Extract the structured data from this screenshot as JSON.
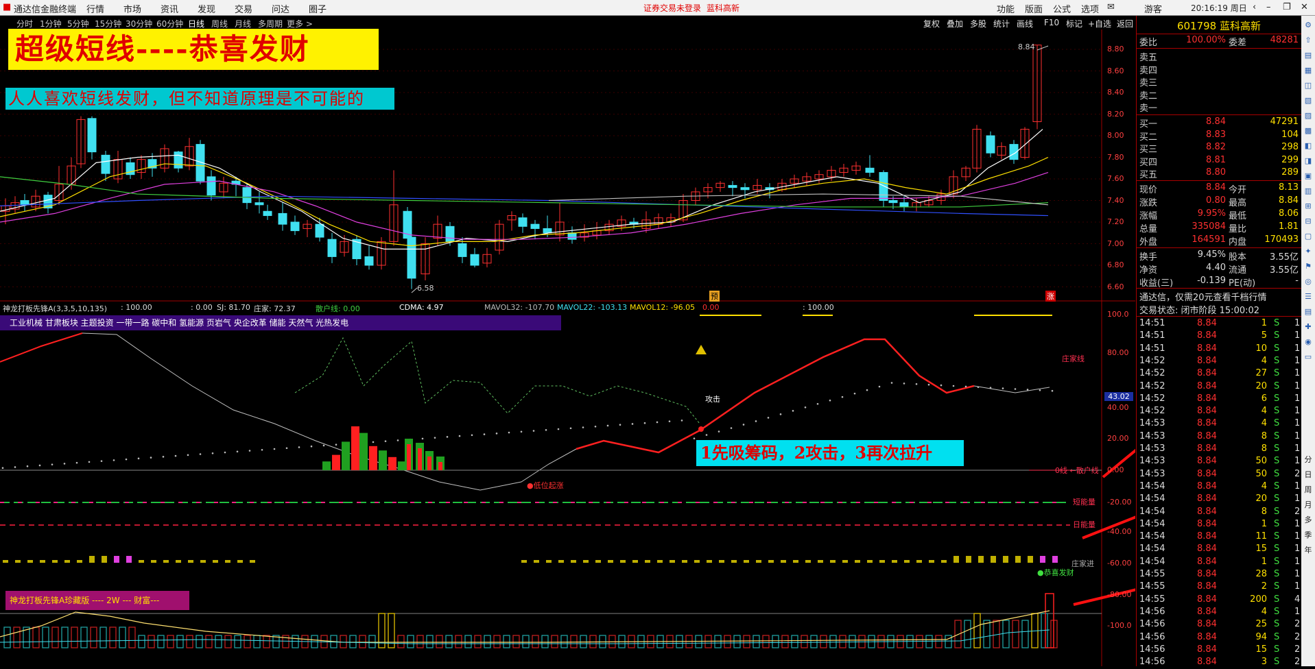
{
  "menubar": {
    "app_title": "通达信金融终端",
    "menus": [
      "行情",
      "市场",
      "资讯",
      "发现",
      "交易",
      "问达",
      "圈子"
    ],
    "login_notice": "证券交易未登录",
    "stock_link": "蓝科高新",
    "right_menus": [
      "功能",
      "版面",
      "公式",
      "选项"
    ],
    "user": "游客",
    "clock": "20:16:19 周日"
  },
  "periods": [
    "分时",
    "1分钟",
    "5分钟",
    "15分钟",
    "30分钟",
    "60分钟",
    "日线",
    "周线",
    "月线",
    "多周期",
    "更多 >"
  ],
  "active_period": "日线",
  "chart_tools": [
    "复权",
    "叠加",
    "多股",
    "统计",
    "画线",
    "F10",
    "标记",
    "+自选",
    "返回"
  ],
  "banners": {
    "title": "超级短线----恭喜发财",
    "subtitle": "人人喜欢短线发财，但不知道原理是不可能的",
    "steps": "1先吸筹码，2攻击，3再次拉升"
  },
  "price_axis": [
    "8.80",
    "8.60",
    "8.40",
    "8.20",
    "8.00",
    "7.80",
    "7.60",
    "7.40",
    "7.20",
    "7.00",
    "6.80",
    "6.60"
  ],
  "price_marks": {
    "high": "8.84",
    "low": "6.58"
  },
  "chart_badges": {
    "pre": "预",
    "up": "涨"
  },
  "indicator_line": {
    "name": "神龙打板先锋A(3,3,5,10,135)",
    "v1": ": 100.00",
    "v2": ": 0.00",
    "sj": "SJ: 81.70",
    "zhuangjia": "庄家: 72.37",
    "sanhu": "散户线: 0.00",
    "cdma": "CDMA: 4.97",
    "mavol32": "MAVOL32: -107.70",
    "mavol22": "MAVOL22: -103.13",
    "mavol12": "MAVOL12: -96.05",
    "v3": "0.00",
    "v4": ": 100.00"
  },
  "sector_tags": "工业机械 甘肃板块 主题投资 一带一路 碳中和 氢能源 页岩气 央企改革 储能 天然气 光热发电",
  "ind_axis": [
    "100.0",
    "80.00",
    "40.00",
    "20.00",
    "0.00",
    "-20.00",
    "-40.00",
    "-60.00",
    "-80.00",
    "-100.0"
  ],
  "ind_axis_highlight": "43.02",
  "ind_labels": {
    "zhuangjia": "庄家线",
    "attack": "攻击",
    "sanhu": "0线 ←散户线",
    "low_start": "●低位起涨",
    "short_energy": "短能量",
    "day_energy": "日能量",
    "zhuang_in": "庄家进",
    "gongxi": "●恭喜发财"
  },
  "vol_banner": "神龙打板先锋A珍藏版 ---- 2W --- 财富---",
  "quote": {
    "code": "601798",
    "name": "蓝科高新",
    "weibi_label": "委比",
    "weibi": "100.00%",
    "weicha_label": "委差",
    "weicha": "48281",
    "sells": [
      {
        "label": "卖五",
        "price": "",
        "vol": ""
      },
      {
        "label": "卖四",
        "price": "",
        "vol": ""
      },
      {
        "label": "卖三",
        "price": "",
        "vol": ""
      },
      {
        "label": "卖二",
        "price": "",
        "vol": ""
      },
      {
        "label": "卖一",
        "price": "",
        "vol": ""
      }
    ],
    "buys": [
      {
        "label": "买一",
        "price": "8.84",
        "vol": "47291"
      },
      {
        "label": "买二",
        "price": "8.83",
        "vol": "104"
      },
      {
        "label": "买三",
        "price": "8.82",
        "vol": "298"
      },
      {
        "label": "买四",
        "price": "8.81",
        "vol": "299"
      },
      {
        "label": "买五",
        "price": "8.80",
        "vol": "289"
      }
    ],
    "stats": [
      {
        "l1": "现价",
        "v1": "8.84",
        "l2": "今开",
        "v2": "8.13"
      },
      {
        "l1": "涨跌",
        "v1": "0.80",
        "l2": "最高",
        "v2": "8.84"
      },
      {
        "l1": "涨幅",
        "v1": "9.95%",
        "l2": "最低",
        "v2": "8.06"
      },
      {
        "l1": "总量",
        "v1": "335084",
        "l2": "量比",
        "v2": "1.81"
      },
      {
        "l1": "外盘",
        "v1": "164591",
        "l2": "内盘",
        "v2": "170493"
      }
    ],
    "stats2": [
      {
        "l1": "换手",
        "v1": "9.45%",
        "l2": "股本",
        "v2": "3.55亿"
      },
      {
        "l1": "净资",
        "v1": "4.40",
        "l2": "流通",
        "v2": "3.55亿"
      },
      {
        "l1": "收益(三)",
        "v1": "-0.139",
        "l2": "PE(动)",
        "v2": "-"
      }
    ],
    "ad": "通达信，仅需20元查看千档行情",
    "status": "交易状态: 闭市阶段 15:00:02"
  },
  "ticks": [
    {
      "t": "14:51",
      "p": "8.84",
      "v": "1",
      "s": "S",
      "n": "1"
    },
    {
      "t": "14:51",
      "p": "8.84",
      "v": "5",
      "s": "S",
      "n": "1"
    },
    {
      "t": "14:51",
      "p": "8.84",
      "v": "10",
      "s": "S",
      "n": "1"
    },
    {
      "t": "14:52",
      "p": "8.84",
      "v": "4",
      "s": "S",
      "n": "1"
    },
    {
      "t": "14:52",
      "p": "8.84",
      "v": "27",
      "s": "S",
      "n": "1"
    },
    {
      "t": "14:52",
      "p": "8.84",
      "v": "20",
      "s": "S",
      "n": "1"
    },
    {
      "t": "14:52",
      "p": "8.84",
      "v": "6",
      "s": "S",
      "n": "1"
    },
    {
      "t": "14:52",
      "p": "8.84",
      "v": "4",
      "s": "S",
      "n": "1"
    },
    {
      "t": "14:53",
      "p": "8.84",
      "v": "4",
      "s": "S",
      "n": "1"
    },
    {
      "t": "14:53",
      "p": "8.84",
      "v": "8",
      "s": "S",
      "n": "1"
    },
    {
      "t": "14:53",
      "p": "8.84",
      "v": "8",
      "s": "S",
      "n": "1"
    },
    {
      "t": "14:53",
      "p": "8.84",
      "v": "50",
      "s": "S",
      "n": "1"
    },
    {
      "t": "14:53",
      "p": "8.84",
      "v": "50",
      "s": "S",
      "n": "2"
    },
    {
      "t": "14:54",
      "p": "8.84",
      "v": "4",
      "s": "S",
      "n": "1"
    },
    {
      "t": "14:54",
      "p": "8.84",
      "v": "20",
      "s": "S",
      "n": "1"
    },
    {
      "t": "14:54",
      "p": "8.84",
      "v": "8",
      "s": "S",
      "n": "2"
    },
    {
      "t": "14:54",
      "p": "8.84",
      "v": "1",
      "s": "S",
      "n": "1"
    },
    {
      "t": "14:54",
      "p": "8.84",
      "v": "11",
      "s": "S",
      "n": "1"
    },
    {
      "t": "14:54",
      "p": "8.84",
      "v": "15",
      "s": "S",
      "n": "1"
    },
    {
      "t": "14:54",
      "p": "8.84",
      "v": "1",
      "s": "S",
      "n": "1"
    },
    {
      "t": "14:55",
      "p": "8.84",
      "v": "28",
      "s": "S",
      "n": "1"
    },
    {
      "t": "14:55",
      "p": "8.84",
      "v": "2",
      "s": "S",
      "n": "1"
    },
    {
      "t": "14:55",
      "p": "8.84",
      "v": "200",
      "s": "S",
      "n": "4"
    },
    {
      "t": "14:56",
      "p": "8.84",
      "v": "4",
      "s": "S",
      "n": "1"
    },
    {
      "t": "14:56",
      "p": "8.84",
      "v": "25",
      "s": "S",
      "n": "2"
    },
    {
      "t": "14:56",
      "p": "8.84",
      "v": "94",
      "s": "S",
      "n": "2"
    },
    {
      "t": "14:56",
      "p": "8.84",
      "v": "15",
      "s": "S",
      "n": "2"
    },
    {
      "t": "14:56",
      "p": "8.84",
      "v": "3",
      "s": "S",
      "n": "2"
    }
  ],
  "right_tools": [
    "分",
    "日",
    "周",
    "月",
    "多",
    "季",
    "年"
  ],
  "colors": {
    "up": "#ff3030",
    "down": "#40e0f0",
    "axis": "#a00000",
    "yellow": "#ffe000"
  }
}
